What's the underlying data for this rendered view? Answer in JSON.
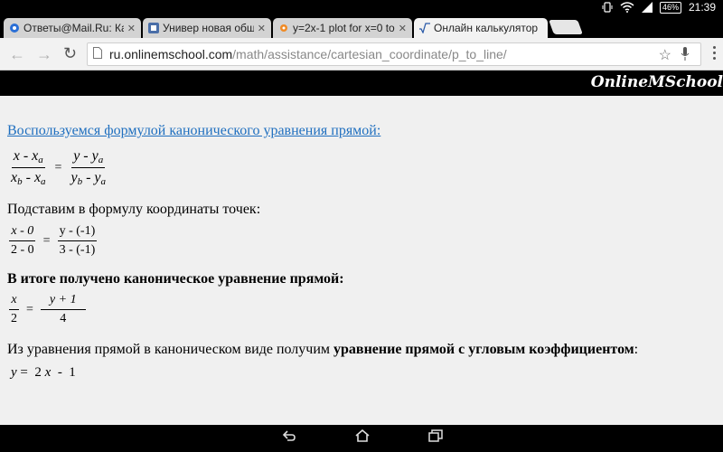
{
  "status": {
    "battery": "46%",
    "time": "21:39"
  },
  "tabs": [
    {
      "title": "Ответы@Mail.Ru: Ка",
      "close": "✕"
    },
    {
      "title": "Универ новая общаг",
      "close": "✕"
    },
    {
      "title": "y=2x-1 plot for x=0 to",
      "close": "✕"
    },
    {
      "title": "Онлайн калькулятор",
      "close": "✕"
    }
  ],
  "toolbar": {
    "url_host": "ru.onlinemschool.com",
    "url_path": "/math/assistance/cartesian_coordinate/p_to_line/"
  },
  "site": {
    "logo": "OnlineMSchool"
  },
  "content": {
    "link": "Воспользуемся формулой канонического уравнения прямой:",
    "formula1": {
      "num_left": "x - x",
      "den_left": "x",
      "den_left_tail": " - x",
      "num_right": "y - y",
      "den_right": "y",
      "den_right_tail": " - y",
      "sub_a": "a",
      "sub_b": "b",
      "eq": "="
    },
    "substitute_line": "Подставим в формулу координаты точек:",
    "formula2": {
      "num_left": "x - 0",
      "den_left": "2 - 0",
      "num_right": "y - (-1)",
      "den_right": "3 - (-1)",
      "eq": "="
    },
    "result_line": "В итоге получено каноническое уравнение прямой:",
    "formula3": {
      "num_left": "x",
      "den_left": "2",
      "num_right": "y + 1",
      "den_right": "4",
      "eq": "="
    },
    "slope_line_prefix": "Из уравнения прямой в каноническом виде получим ",
    "slope_line_bold": "уравнение прямой с угловым коэффициентом",
    "slope_line_suffix": ":",
    "final": {
      "y": "y",
      "eq": " = ",
      "coef": " 2 ",
      "x": "x",
      "rest": "  -  1"
    }
  }
}
